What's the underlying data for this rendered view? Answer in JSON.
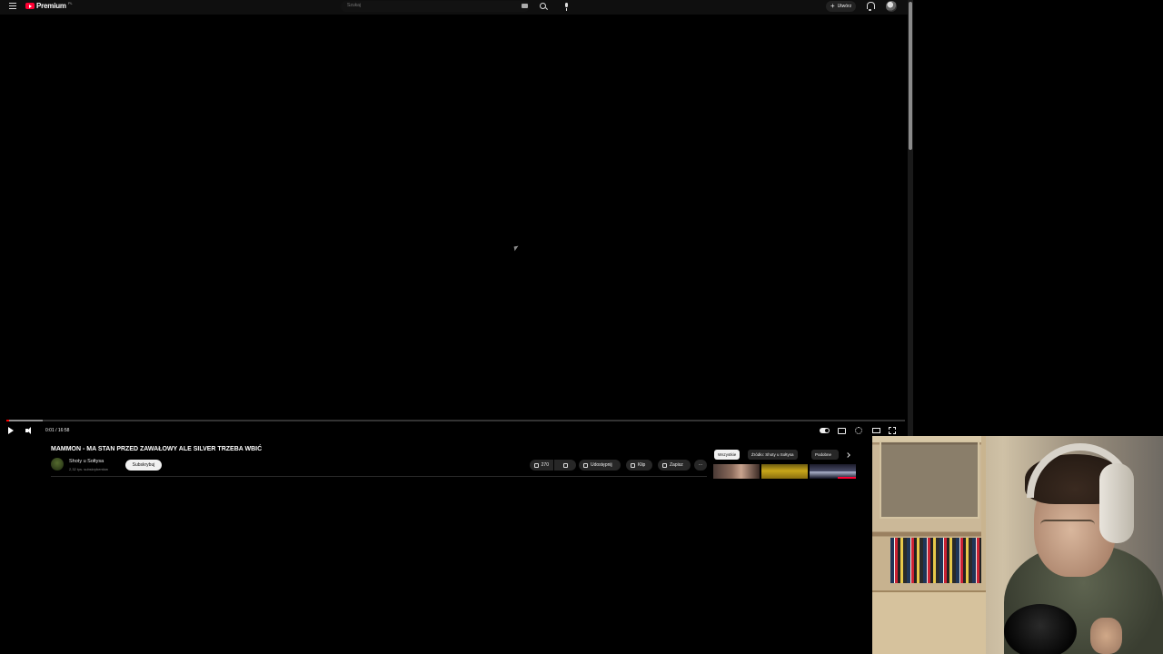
{
  "masthead": {
    "logo_text": "Premium",
    "logo_country": "PL",
    "search_placeholder": "Szukaj",
    "create_label": "Utwórz"
  },
  "player": {
    "time_current": "0:01",
    "time_separator": " / ",
    "time_total": "16:58",
    "progress_played_fraction": 0.001,
    "progress_buffered_fraction": 0.04
  },
  "video": {
    "title": "MAMMON - MA STAN PRZED ZAWAŁOWY ALE SILVER TRZEBA WBIĆ",
    "channel_name": "Shoty u Sołtysa",
    "channel_subscribers": "2,32 tys. subskrybentów",
    "subscribe_label": "Subskrybuj"
  },
  "actions": {
    "like_count": "270",
    "share_label": "Udostępnij",
    "clip_label": "Klip",
    "save_label": "Zapisz",
    "more_label": "···"
  },
  "related": {
    "chips": [
      {
        "label": "Wszystkie",
        "active": true
      },
      {
        "label": "Źródło: Shoty u Sołtysa",
        "active": false
      },
      {
        "label": "Podobne",
        "active": false
      }
    ]
  },
  "colors": {
    "accent_red": "#ff0000",
    "background": "#0f0f0f"
  }
}
